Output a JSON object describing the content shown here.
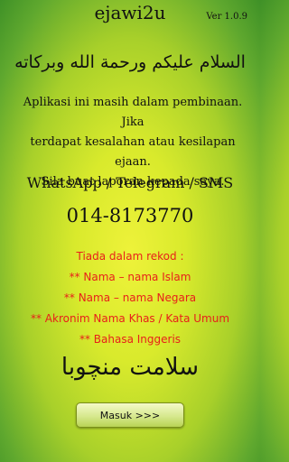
{
  "app": {
    "title": "ejawi2u",
    "version": "Ver 1.0.9"
  },
  "greeting": "السلام عليكم ورحمة الله وبركاته",
  "intro": {
    "lines": [
      "Aplikasi ini masih dalam pembinaan. Jika",
      "terdapat kesalahan atau kesilapan ejaan.",
      "Sila buat laporan kepada saya."
    ]
  },
  "contact": {
    "label": "WhatsApp / Telegram / SMS",
    "phone": "014-8173770"
  },
  "notes": {
    "heading": "Tiada dalam rekod :",
    "items": [
      "** Nama – nama Islam",
      "** Nama – nama Negara",
      "** Akronim Nama Khas / Kata Umum",
      "** Bahasa Inggeris"
    ]
  },
  "farewell": "سلامت منچوبا",
  "button": {
    "label": "Masuk >>>"
  },
  "colors": {
    "background_center": "#eef23a",
    "background_edge": "#3f9127",
    "note_text": "#e8201a"
  }
}
